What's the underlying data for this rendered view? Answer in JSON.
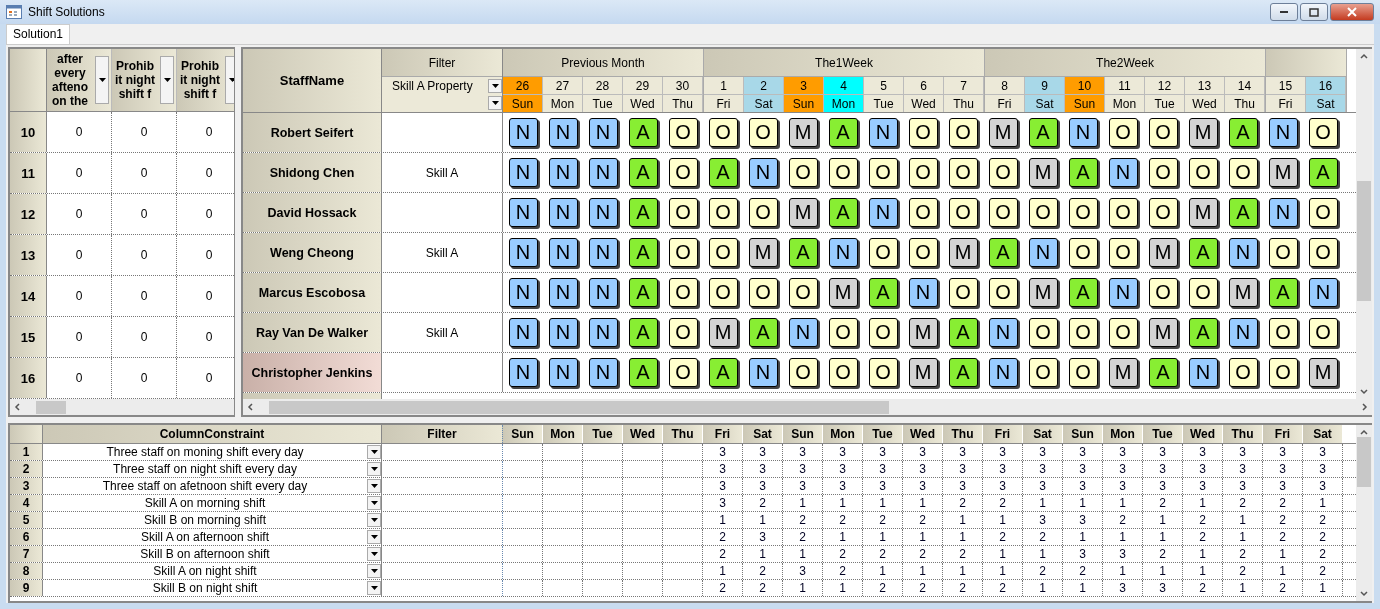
{
  "window": {
    "title": "Shift Solutions"
  },
  "tabs": [
    {
      "label": "Solution1",
      "selected": true
    }
  ],
  "left_panel": {
    "columns": [
      "after every afteno on the",
      "Prohib it night shift f",
      "Prohib it night shift f"
    ],
    "rows": [
      {
        "number": "10",
        "values": [
          "0",
          "0",
          "0"
        ]
      },
      {
        "number": "11",
        "values": [
          "0",
          "0",
          "0"
        ]
      },
      {
        "number": "12",
        "values": [
          "0",
          "0",
          "0"
        ]
      },
      {
        "number": "13",
        "values": [
          "0",
          "0",
          "0"
        ]
      },
      {
        "number": "14",
        "values": [
          "0",
          "0",
          "0"
        ]
      },
      {
        "number": "15",
        "values": [
          "0",
          "0",
          "0"
        ]
      },
      {
        "number": "16",
        "values": [
          "0",
          "0",
          "0"
        ]
      }
    ]
  },
  "roster": {
    "staff_header": "StaffName",
    "filter_header": "Filter",
    "filter_value": "Skill A Property",
    "groups": [
      {
        "label": "Previous Month",
        "days": [
          {
            "date": "26",
            "day": "Sun",
            "kind": "sunday"
          },
          {
            "date": "27",
            "day": "Mon",
            "kind": "normal"
          },
          {
            "date": "28",
            "day": "Tue",
            "kind": "normal"
          },
          {
            "date": "29",
            "day": "Wed",
            "kind": "normal"
          },
          {
            "date": "30",
            "day": "Thu",
            "kind": "normal"
          }
        ]
      },
      {
        "label": "The1Week",
        "days": [
          {
            "date": "1",
            "day": "Fri",
            "kind": "normal"
          },
          {
            "date": "2",
            "day": "Sat",
            "kind": "saturday"
          },
          {
            "date": "3",
            "day": "Sun",
            "kind": "sunday"
          },
          {
            "date": "4",
            "day": "Mon",
            "kind": "holiday"
          },
          {
            "date": "5",
            "day": "Tue",
            "kind": "normal"
          },
          {
            "date": "6",
            "day": "Wed",
            "kind": "normal"
          },
          {
            "date": "7",
            "day": "Thu",
            "kind": "normal"
          }
        ]
      },
      {
        "label": "The2Week",
        "days": [
          {
            "date": "8",
            "day": "Fri",
            "kind": "normal"
          },
          {
            "date": "9",
            "day": "Sat",
            "kind": "saturday"
          },
          {
            "date": "10",
            "day": "Sun",
            "kind": "sunday"
          },
          {
            "date": "11",
            "day": "Mon",
            "kind": "normal"
          },
          {
            "date": "12",
            "day": "Tue",
            "kind": "normal"
          },
          {
            "date": "13",
            "day": "Wed",
            "kind": "normal"
          },
          {
            "date": "14",
            "day": "Thu",
            "kind": "normal"
          }
        ]
      },
      {
        "days": [
          {
            "date": "15",
            "day": "Fri",
            "kind": "normal"
          },
          {
            "date": "16",
            "day": "Sat",
            "kind": "saturday"
          }
        ]
      }
    ],
    "rows": [
      {
        "name": "Robert Seifert",
        "selected": false,
        "shifts": [
          {
            "code": "N",
            "kind": "night"
          },
          {
            "code": "N",
            "kind": "night"
          },
          {
            "code": "N",
            "kind": "night"
          },
          {
            "code": "A",
            "kind": "afternoon"
          },
          {
            "code": "O",
            "kind": "off"
          },
          {
            "code": "O",
            "kind": "off"
          },
          {
            "code": "O",
            "kind": "off"
          },
          {
            "code": "M",
            "kind": "morning"
          },
          {
            "code": "A",
            "kind": "afternoon"
          },
          {
            "code": "N",
            "kind": "night"
          },
          {
            "code": "O",
            "kind": "off"
          },
          {
            "code": "O",
            "kind": "off"
          },
          {
            "code": "M",
            "kind": "morning"
          },
          {
            "code": "A",
            "kind": "afternoon"
          },
          {
            "code": "N",
            "kind": "night"
          },
          {
            "code": "O",
            "kind": "off"
          },
          {
            "code": "O",
            "kind": "off"
          },
          {
            "code": "M",
            "kind": "morning"
          },
          {
            "code": "A",
            "kind": "afternoon"
          },
          {
            "code": "N",
            "kind": "night"
          },
          {
            "code": "O",
            "kind": "off"
          }
        ]
      },
      {
        "name": "Shidong Chen",
        "filter": "Skill A",
        "selected": false,
        "shifts": [
          {
            "code": "N",
            "kind": "night"
          },
          {
            "code": "N",
            "kind": "night"
          },
          {
            "code": "N",
            "kind": "night"
          },
          {
            "code": "A",
            "kind": "afternoon"
          },
          {
            "code": "O",
            "kind": "off"
          },
          {
            "code": "A",
            "kind": "afternoon"
          },
          {
            "code": "N",
            "kind": "night"
          },
          {
            "code": "O",
            "kind": "off"
          },
          {
            "code": "O",
            "kind": "off"
          },
          {
            "code": "O",
            "kind": "off"
          },
          {
            "code": "O",
            "kind": "off"
          },
          {
            "code": "O",
            "kind": "off"
          },
          {
            "code": "O",
            "kind": "off"
          },
          {
            "code": "M",
            "kind": "morning"
          },
          {
            "code": "A",
            "kind": "afternoon"
          },
          {
            "code": "N",
            "kind": "night"
          },
          {
            "code": "O",
            "kind": "off"
          },
          {
            "code": "O",
            "kind": "off"
          },
          {
            "code": "O",
            "kind": "off"
          },
          {
            "code": "M",
            "kind": "morning"
          },
          {
            "code": "A",
            "kind": "afternoon"
          }
        ]
      },
      {
        "name": "David Hossack",
        "selected": false,
        "shifts": [
          {
            "code": "N",
            "kind": "night"
          },
          {
            "code": "N",
            "kind": "night"
          },
          {
            "code": "N",
            "kind": "night"
          },
          {
            "code": "A",
            "kind": "afternoon"
          },
          {
            "code": "O",
            "kind": "off"
          },
          {
            "code": "O",
            "kind": "off"
          },
          {
            "code": "O",
            "kind": "off"
          },
          {
            "code": "M",
            "kind": "morning"
          },
          {
            "code": "A",
            "kind": "afternoon"
          },
          {
            "code": "N",
            "kind": "night"
          },
          {
            "code": "O",
            "kind": "off"
          },
          {
            "code": "O",
            "kind": "off"
          },
          {
            "code": "O",
            "kind": "off"
          },
          {
            "code": "O",
            "kind": "off"
          },
          {
            "code": "O",
            "kind": "off"
          },
          {
            "code": "O",
            "kind": "off"
          },
          {
            "code": "O",
            "kind": "off"
          },
          {
            "code": "M",
            "kind": "morning"
          },
          {
            "code": "A",
            "kind": "afternoon"
          },
          {
            "code": "N",
            "kind": "night"
          },
          {
            "code": "O",
            "kind": "off"
          }
        ]
      },
      {
        "name": "Weng Cheong",
        "filter": "Skill A",
        "selected": false,
        "shifts": [
          {
            "code": "N",
            "kind": "night"
          },
          {
            "code": "N",
            "kind": "night"
          },
          {
            "code": "N",
            "kind": "night"
          },
          {
            "code": "A",
            "kind": "afternoon"
          },
          {
            "code": "O",
            "kind": "off"
          },
          {
            "code": "O",
            "kind": "off"
          },
          {
            "code": "M",
            "kind": "morning"
          },
          {
            "code": "A",
            "kind": "afternoon"
          },
          {
            "code": "N",
            "kind": "night"
          },
          {
            "code": "O",
            "kind": "off"
          },
          {
            "code": "O",
            "kind": "off"
          },
          {
            "code": "M",
            "kind": "morning"
          },
          {
            "code": "A",
            "kind": "afternoon"
          },
          {
            "code": "N",
            "kind": "night"
          },
          {
            "code": "O",
            "kind": "off"
          },
          {
            "code": "O",
            "kind": "off"
          },
          {
            "code": "M",
            "kind": "morning"
          },
          {
            "code": "A",
            "kind": "afternoon"
          },
          {
            "code": "N",
            "kind": "night"
          },
          {
            "code": "O",
            "kind": "off"
          },
          {
            "code": "O",
            "kind": "off"
          }
        ]
      },
      {
        "name": "Marcus Escobosa",
        "selected": false,
        "shifts": [
          {
            "code": "N",
            "kind": "night"
          },
          {
            "code": "N",
            "kind": "night"
          },
          {
            "code": "N",
            "kind": "night"
          },
          {
            "code": "A",
            "kind": "afternoon"
          },
          {
            "code": "O",
            "kind": "off"
          },
          {
            "code": "O",
            "kind": "off"
          },
          {
            "code": "O",
            "kind": "off"
          },
          {
            "code": "O",
            "kind": "off"
          },
          {
            "code": "M",
            "kind": "morning"
          },
          {
            "code": "A",
            "kind": "afternoon"
          },
          {
            "code": "N",
            "kind": "night"
          },
          {
            "code": "O",
            "kind": "off"
          },
          {
            "code": "O",
            "kind": "off"
          },
          {
            "code": "M",
            "kind": "morning"
          },
          {
            "code": "A",
            "kind": "afternoon"
          },
          {
            "code": "N",
            "kind": "night"
          },
          {
            "code": "O",
            "kind": "off"
          },
          {
            "code": "O",
            "kind": "off"
          },
          {
            "code": "M",
            "kind": "morning"
          },
          {
            "code": "A",
            "kind": "afternoon"
          },
          {
            "code": "N",
            "kind": "night"
          }
        ]
      },
      {
        "name": "Ray Van De Walker",
        "filter": "Skill A",
        "selected": false,
        "shifts": [
          {
            "code": "N",
            "kind": "night"
          },
          {
            "code": "N",
            "kind": "night"
          },
          {
            "code": "N",
            "kind": "night"
          },
          {
            "code": "A",
            "kind": "afternoon"
          },
          {
            "code": "O",
            "kind": "off"
          },
          {
            "code": "M",
            "kind": "morning"
          },
          {
            "code": "A",
            "kind": "afternoon"
          },
          {
            "code": "N",
            "kind": "night"
          },
          {
            "code": "O",
            "kind": "off"
          },
          {
            "code": "O",
            "kind": "off"
          },
          {
            "code": "M",
            "kind": "morning"
          },
          {
            "code": "A",
            "kind": "afternoon"
          },
          {
            "code": "N",
            "kind": "night"
          },
          {
            "code": "O",
            "kind": "off"
          },
          {
            "code": "O",
            "kind": "off"
          },
          {
            "code": "O",
            "kind": "off"
          },
          {
            "code": "M",
            "kind": "morning"
          },
          {
            "code": "A",
            "kind": "afternoon"
          },
          {
            "code": "N",
            "kind": "night"
          },
          {
            "code": "O",
            "kind": "off"
          },
          {
            "code": "O",
            "kind": "off"
          }
        ]
      },
      {
        "name": "Christopher Jenkins",
        "selected": true,
        "shifts": [
          {
            "code": "N",
            "kind": "night"
          },
          {
            "code": "N",
            "kind": "night"
          },
          {
            "code": "N",
            "kind": "night"
          },
          {
            "code": "A",
            "kind": "afternoon"
          },
          {
            "code": "O",
            "kind": "off"
          },
          {
            "code": "A",
            "kind": "afternoon"
          },
          {
            "code": "N",
            "kind": "night"
          },
          {
            "code": "O",
            "kind": "off"
          },
          {
            "code": "O",
            "kind": "off"
          },
          {
            "code": "O",
            "kind": "off"
          },
          {
            "code": "M",
            "kind": "morning"
          },
          {
            "code": "A",
            "kind": "afternoon"
          },
          {
            "code": "N",
            "kind": "night"
          },
          {
            "code": "O",
            "kind": "off"
          },
          {
            "code": "O",
            "kind": "off"
          },
          {
            "code": "M",
            "kind": "morning"
          },
          {
            "code": "A",
            "kind": "afternoon"
          },
          {
            "code": "N",
            "kind": "night"
          },
          {
            "code": "O",
            "kind": "off"
          },
          {
            "code": "O",
            "kind": "off"
          },
          {
            "code": "M",
            "kind": "morning"
          }
        ]
      }
    ]
  },
  "constraints": {
    "name_header": "ColumnConstraint",
    "filter_header": "Filter",
    "days": [
      "Sun",
      "Mon",
      "Tue",
      "Wed",
      "Thu",
      "Fri",
      "Sat",
      "Sun",
      "Mon",
      "Tue",
      "Wed",
      "Thu",
      "Fri",
      "Sat",
      "Sun",
      "Mon",
      "Tue",
      "Wed",
      "Thu",
      "Fri",
      "Sat"
    ],
    "rows": [
      {
        "number": "1",
        "name": "Three staff on moning shift every day",
        "values": [
          "3",
          "3",
          "3",
          "3",
          "3",
          "3",
          "3",
          "3",
          "3",
          "3",
          "3",
          "3",
          "3",
          "3",
          "3",
          "3"
        ]
      },
      {
        "number": "2",
        "name": "Three staff on night shift every day",
        "values": [
          "3",
          "3",
          "3",
          "3",
          "3",
          "3",
          "3",
          "3",
          "3",
          "3",
          "3",
          "3",
          "3",
          "3",
          "3",
          "3"
        ]
      },
      {
        "number": "3",
        "name": "Three staff on afetnoon shift every day",
        "values": [
          "3",
          "3",
          "3",
          "3",
          "3",
          "3",
          "3",
          "3",
          "3",
          "3",
          "3",
          "3",
          "3",
          "3",
          "3",
          "3"
        ]
      },
      {
        "number": "4",
        "name": "Skill A on morning shift",
        "values": [
          "3",
          "2",
          "1",
          "1",
          "1",
          "1",
          "2",
          "2",
          "1",
          "1",
          "1",
          "2",
          "1",
          "2",
          "2",
          "1"
        ]
      },
      {
        "number": "5",
        "name": "Skill B on morning shift",
        "values": [
          "1",
          "1",
          "2",
          "2",
          "2",
          "2",
          "1",
          "1",
          "3",
          "3",
          "2",
          "1",
          "2",
          "1",
          "2",
          "2"
        ]
      },
      {
        "number": "6",
        "name": "Skill A on afternoon shift",
        "values": [
          "2",
          "3",
          "2",
          "1",
          "1",
          "1",
          "1",
          "2",
          "2",
          "1",
          "1",
          "1",
          "2",
          "1",
          "2",
          "2"
        ]
      },
      {
        "number": "7",
        "name": "Skill B on afternoon shift",
        "values": [
          "2",
          "1",
          "1",
          "2",
          "2",
          "2",
          "2",
          "1",
          "1",
          "3",
          "3",
          "2",
          "1",
          "2",
          "1",
          "2"
        ]
      },
      {
        "number": "8",
        "name": "Skill A on night shift",
        "values": [
          "1",
          "2",
          "3",
          "2",
          "1",
          "1",
          "1",
          "1",
          "2",
          "2",
          "1",
          "1",
          "1",
          "2",
          "1",
          "2"
        ]
      },
      {
        "number": "9",
        "name": "Skill B on night shift",
        "values": [
          "2",
          "2",
          "1",
          "1",
          "2",
          "2",
          "2",
          "2",
          "1",
          "1",
          "3",
          "3",
          "2",
          "1",
          "2",
          "1"
        ]
      }
    ]
  }
}
